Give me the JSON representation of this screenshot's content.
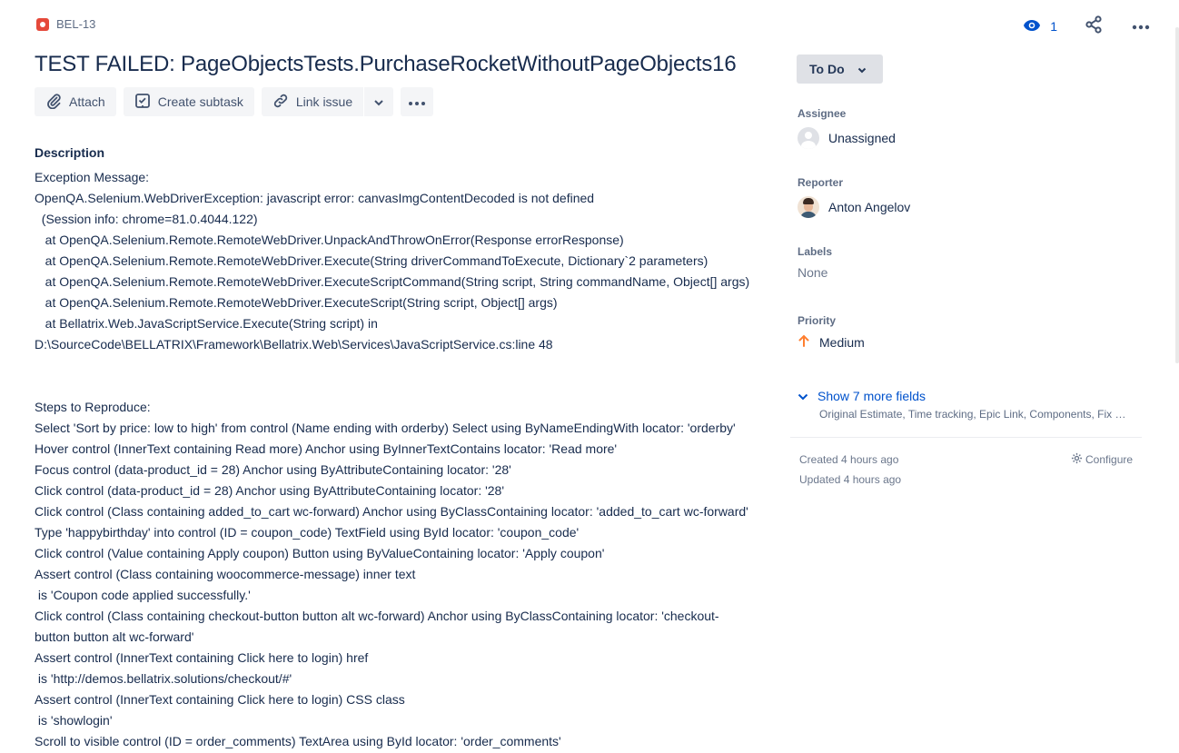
{
  "issue": {
    "key": "BEL-13",
    "title": "TEST FAILED: PageObjectsTests.PurchaseRocketWithoutPageObjects16"
  },
  "header": {
    "watch_count": "1"
  },
  "toolbar": {
    "attach": "Attach",
    "create_subtask": "Create subtask",
    "link_issue": "Link issue"
  },
  "description": {
    "heading": "Description",
    "lines": [
      "Exception Message:",
      "OpenQA.Selenium.WebDriverException: javascript error: canvasImgContentDecoded is not defined",
      "  (Session info: chrome=81.0.4044.122)",
      "   at OpenQA.Selenium.Remote.RemoteWebDriver.UnpackAndThrowOnError(Response errorResponse)",
      "   at OpenQA.Selenium.Remote.RemoteWebDriver.Execute(String driverCommandToExecute, Dictionary`2 parameters)",
      "   at OpenQA.Selenium.Remote.RemoteWebDriver.ExecuteScriptCommand(String script, String commandName, Object[] args)",
      "   at OpenQA.Selenium.Remote.RemoteWebDriver.ExecuteScript(String script, Object[] args)",
      "   at Bellatrix.Web.JavaScriptService.Execute(String script) in",
      "D:\\SourceCode\\BELLATRIX\\Framework\\Bellatrix.Web\\Services\\JavaScriptService.cs:line 48",
      "",
      "",
      "Steps to Reproduce:",
      "Select 'Sort by price: low to high' from control (Name ending with orderby) Select using ByNameEndingWith locator: 'orderby'",
      "Hover control (InnerText containing Read more) Anchor using ByInnerTextContains locator: 'Read more'",
      "Focus control (data-product_id = 28) Anchor using ByAttributeContaining locator: '28'",
      "Click control (data-product_id = 28) Anchor using ByAttributeContaining locator: '28'",
      "Click control (Class containing added_to_cart wc-forward) Anchor using ByClassContaining locator: 'added_to_cart wc-forward'",
      "Type 'happybirthday' into control (ID = coupon_code) TextField using ById locator: 'coupon_code'",
      "Click control (Value containing Apply coupon) Button using ByValueContaining locator: 'Apply coupon'",
      "Assert control (Class containing woocommerce-message) inner text",
      " is 'Coupon code applied successfully.'",
      "Click control (Class containing checkout-button button alt wc-forward) Anchor using ByClassContaining locator: 'checkout-",
      "button button alt wc-forward'",
      "Assert control (InnerText containing Click here to login) href",
      " is 'http://demos.bellatrix.solutions/checkout/#'",
      "Assert control (InnerText containing Click here to login) CSS class",
      " is 'showlogin'",
      "Scroll to visible control (ID = order_comments) TextArea using ById locator: 'order_comments'"
    ]
  },
  "sidebar": {
    "status": "To Do",
    "assignee_label": "Assignee",
    "assignee_value": "Unassigned",
    "reporter_label": "Reporter",
    "reporter_value": "Anton Angelov",
    "labels_label": "Labels",
    "labels_value": "None",
    "priority_label": "Priority",
    "priority_value": "Medium",
    "more_fields_link": "Show 7 more fields",
    "more_fields_sub": "Original Estimate, Time tracking, Epic Link, Components, Fix versions",
    "created": "Created 4 hours ago",
    "updated": "Updated 4 hours ago",
    "configure": "Configure"
  },
  "colors": {
    "link": "#0052cc",
    "bug": "#e5493a",
    "priority_medium": "#ff7f30"
  }
}
